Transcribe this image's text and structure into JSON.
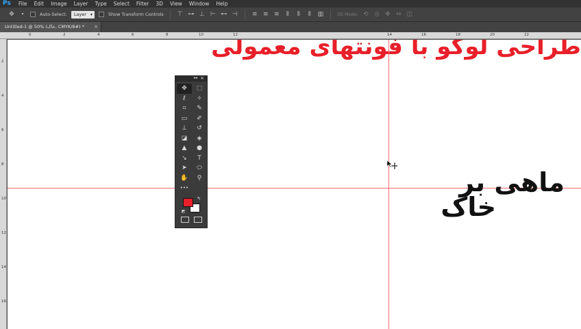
{
  "app": {
    "logo": "Ps",
    "menu": [
      "File",
      "Edit",
      "Image",
      "Layer",
      "Type",
      "Select",
      "Filter",
      "3D",
      "View",
      "Window",
      "Help"
    ]
  },
  "options": {
    "move_icon": "move-tool-icon",
    "auto_select_label": "Auto-Select:",
    "auto_select_value": "Layer",
    "show_transform_label": "Show Transform Controls",
    "mode_3d_label": "3D Mode:"
  },
  "document": {
    "tab_title": "Untitled-1 @ 50% (خاک, CMYK/8#) *",
    "close_glyph": "×"
  },
  "ruler": {
    "h_labels": [
      "0",
      "2",
      "4",
      "6",
      "8",
      "10",
      "12",
      "14",
      "16",
      "18",
      "20",
      "22"
    ],
    "v_labels": [
      "2",
      "4",
      "6",
      "8",
      "10",
      "12",
      "14",
      "16"
    ]
  },
  "canvas": {
    "heading": "طراحی لوگو با فونتهای معمولی",
    "logo_line_1": "ماهی بر",
    "logo_line_2": "خاک"
  },
  "toolbox": {
    "collapse_glyph": "◂◂",
    "close_glyph": "×",
    "tools": [
      {
        "name": "move-tool",
        "glyph": "✥"
      },
      {
        "name": "marquee-tool",
        "glyph": "⬚"
      },
      {
        "name": "lasso-tool",
        "glyph": "ℓ"
      },
      {
        "name": "magic-wand-tool",
        "glyph": "✧"
      },
      {
        "name": "crop-tool",
        "glyph": "⌗"
      },
      {
        "name": "eyedropper-tool",
        "glyph": "✎"
      },
      {
        "name": "healing-tool",
        "glyph": "▭"
      },
      {
        "name": "brush-tool",
        "glyph": "✐"
      },
      {
        "name": "stamp-tool",
        "glyph": "⊥"
      },
      {
        "name": "history-brush-tool",
        "glyph": "↺"
      },
      {
        "name": "eraser-tool",
        "glyph": "◪"
      },
      {
        "name": "paint-bucket-tool",
        "glyph": "◈"
      },
      {
        "name": "blur-tool",
        "glyph": "▲"
      },
      {
        "name": "dodge-tool",
        "glyph": "●"
      },
      {
        "name": "pen-tool",
        "glyph": "↘"
      },
      {
        "name": "type-tool",
        "glyph": "T"
      },
      {
        "name": "path-select-tool",
        "glyph": "➤"
      },
      {
        "name": "shape-tool",
        "glyph": "⬭"
      },
      {
        "name": "hand-tool",
        "glyph": "✋"
      },
      {
        "name": "zoom-tool",
        "glyph": "⚲"
      },
      {
        "name": "more-tools",
        "glyph": "•••"
      },
      {
        "name": "empty",
        "glyph": ""
      }
    ],
    "foreground_color": "#e8202a",
    "background_color": "#ffffff",
    "swap_glyph": "↰",
    "reset_glyph": "◩"
  },
  "colors": {
    "heading": "#e8202a",
    "guide": "#ff6a6a",
    "logo": "#111111"
  }
}
